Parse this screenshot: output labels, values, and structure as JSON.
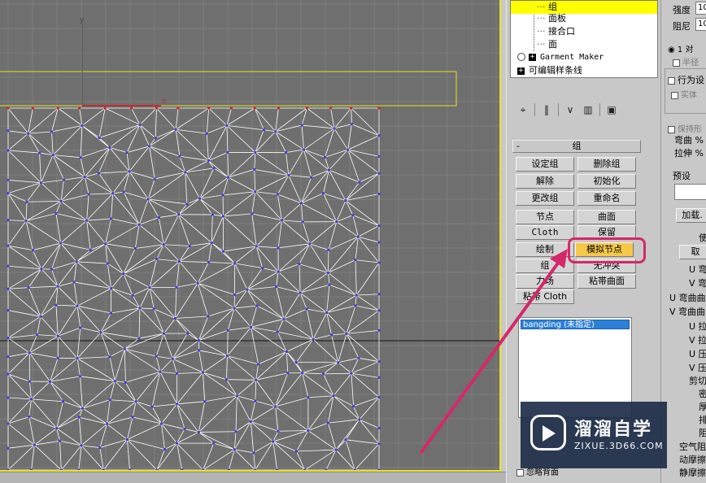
{
  "tree": {
    "items": [
      {
        "label": "组",
        "selected": true
      },
      {
        "label": "面板"
      },
      {
        "label": "接合口"
      },
      {
        "label": "面"
      },
      {
        "label": "Garment Maker",
        "expander": "+"
      },
      {
        "label": "可编辑样条线",
        "expander": "+"
      }
    ]
  },
  "toolbar_icons": [
    "pin-icon",
    "bar-icon",
    "fork-icon",
    "trash-icon",
    "config-icon"
  ],
  "group_rollout": {
    "collapse": "-",
    "title": "组",
    "buttons": [
      {
        "label": "设定组"
      },
      {
        "label": "删除组"
      },
      {
        "label": "解除"
      },
      {
        "label": "初始化"
      },
      {
        "label": "更改组"
      },
      {
        "label": "重命名"
      },
      {
        "label": "节点"
      },
      {
        "label": "曲面"
      },
      {
        "label": "Cloth"
      },
      {
        "label": "保留"
      },
      {
        "label": "绘制"
      },
      {
        "label": "模拟节点"
      },
      {
        "label": "组"
      },
      {
        "label": "无冲突"
      },
      {
        "label": "力场"
      },
      {
        "label": "粘帯曲面"
      },
      {
        "label": "粘帯 Cloth"
      }
    ],
    "list_item": "bangding (未指定)",
    "bottom_checkbox": "忽略背面"
  },
  "right_panel": {
    "strength": "强度",
    "damping": "阻尼",
    "strength_val": "10",
    "damping_val": "10",
    "radio": "1 对",
    "half": "半径",
    "act_as": "行为设",
    "solid": "实体",
    "keep": "保持形",
    "bend": "弯曲 %",
    "stretch": "拉伸 %",
    "presets": "预设",
    "load": "加载.",
    "use": "使",
    "fetch": "取",
    "rows": [
      "U 弯",
      "V 弯",
      "U 弯曲曲",
      "V 弯曲曲",
      "U 拉",
      "V 拉",
      "U 压",
      "V 压",
      "剪切",
      "密",
      "厚",
      "排",
      "阻",
      "空气阻",
      "动摩擦",
      "静摩擦"
    ]
  },
  "viewport": {
    "axis_x": "x",
    "axis_y": "y"
  },
  "watermark": {
    "brand": "溜溜自学",
    "url": "ZIXUE.3D66.COM"
  },
  "colors": {
    "viewport_bg": "#6f6f6f",
    "frame": "#e9e21f",
    "selected": "#ffff00",
    "highlight": "#d4286a",
    "active_button": "#f5c84a",
    "mesh_edge": "#ffffff",
    "mesh_vertex": "#3c3cd8",
    "pin_vertex": "#d02020"
  }
}
